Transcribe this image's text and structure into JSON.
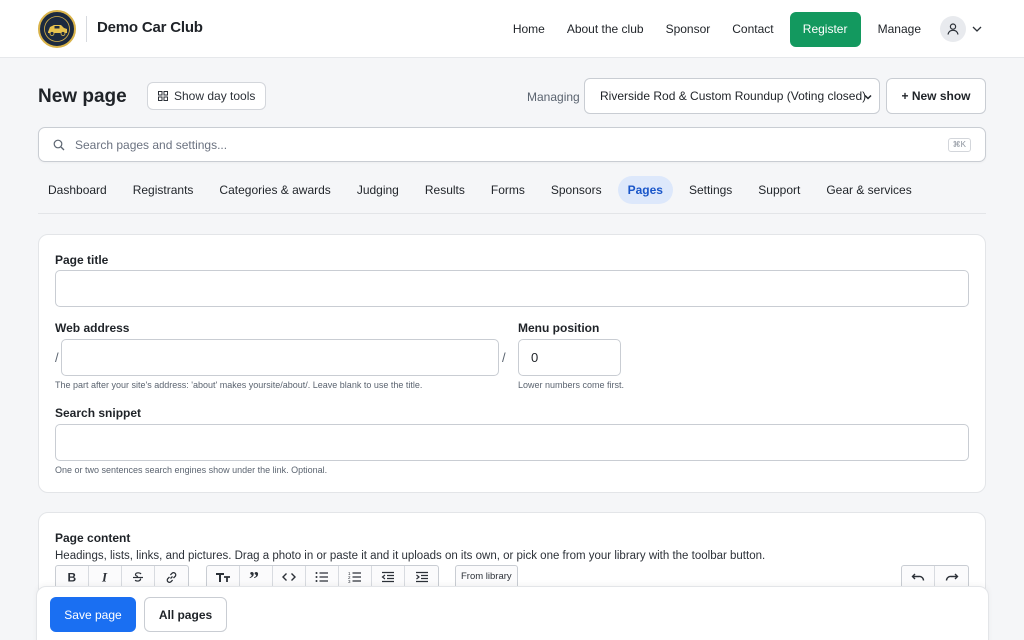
{
  "brand": {
    "name": "Demo Car Club",
    "logo_icon": "car-club-logo-icon"
  },
  "nav": {
    "links": [
      "Home",
      "About the club",
      "Sponsor",
      "Contact"
    ],
    "register_label": "Register",
    "manage_label": "Manage",
    "register_color": "#13995f"
  },
  "header": {
    "title": "New page",
    "day_tools_label": "Show day tools",
    "managing_label": "Managing",
    "selected_show": "Riverside Rod & Custom Roundup (Voting closed)",
    "new_show_label": "+ New show"
  },
  "search": {
    "placeholder": "Search pages and settings...",
    "shortcut": "⌘K"
  },
  "tabs": [
    {
      "label": "Dashboard"
    },
    {
      "label": "Registrants"
    },
    {
      "label": "Categories & awards"
    },
    {
      "label": "Judging"
    },
    {
      "label": "Results"
    },
    {
      "label": "Forms"
    },
    {
      "label": "Sponsors"
    },
    {
      "label": "Pages",
      "active": true
    },
    {
      "label": "Settings"
    },
    {
      "label": "Support"
    },
    {
      "label": "Gear & services"
    }
  ],
  "form": {
    "page_title_label": "Page title",
    "page_title_value": "",
    "web_address_label": "Web address",
    "web_address_prefix": "/",
    "web_address_suffix": "/",
    "web_address_value": "",
    "web_address_hint": "The part after your site's address: 'about' makes yoursite/about/. Leave blank to use the title.",
    "menu_position_label": "Menu position",
    "menu_position_value": "0",
    "menu_position_hint": "Lower numbers come first.",
    "snippet_label": "Search snippet",
    "snippet_value": "",
    "snippet_hint": "One or two sentences search engines show under the link. Optional."
  },
  "content": {
    "title": "Page content",
    "description": "Headings, lists, links, and pictures. Drag a photo in or paste it and it uploads on its own, or pick one from your library with the toolbar button.",
    "from_library_label": "From library"
  },
  "actions": {
    "save_label": "Save page",
    "all_pages_label": "All pages",
    "primary_color": "#1a6ff2"
  }
}
